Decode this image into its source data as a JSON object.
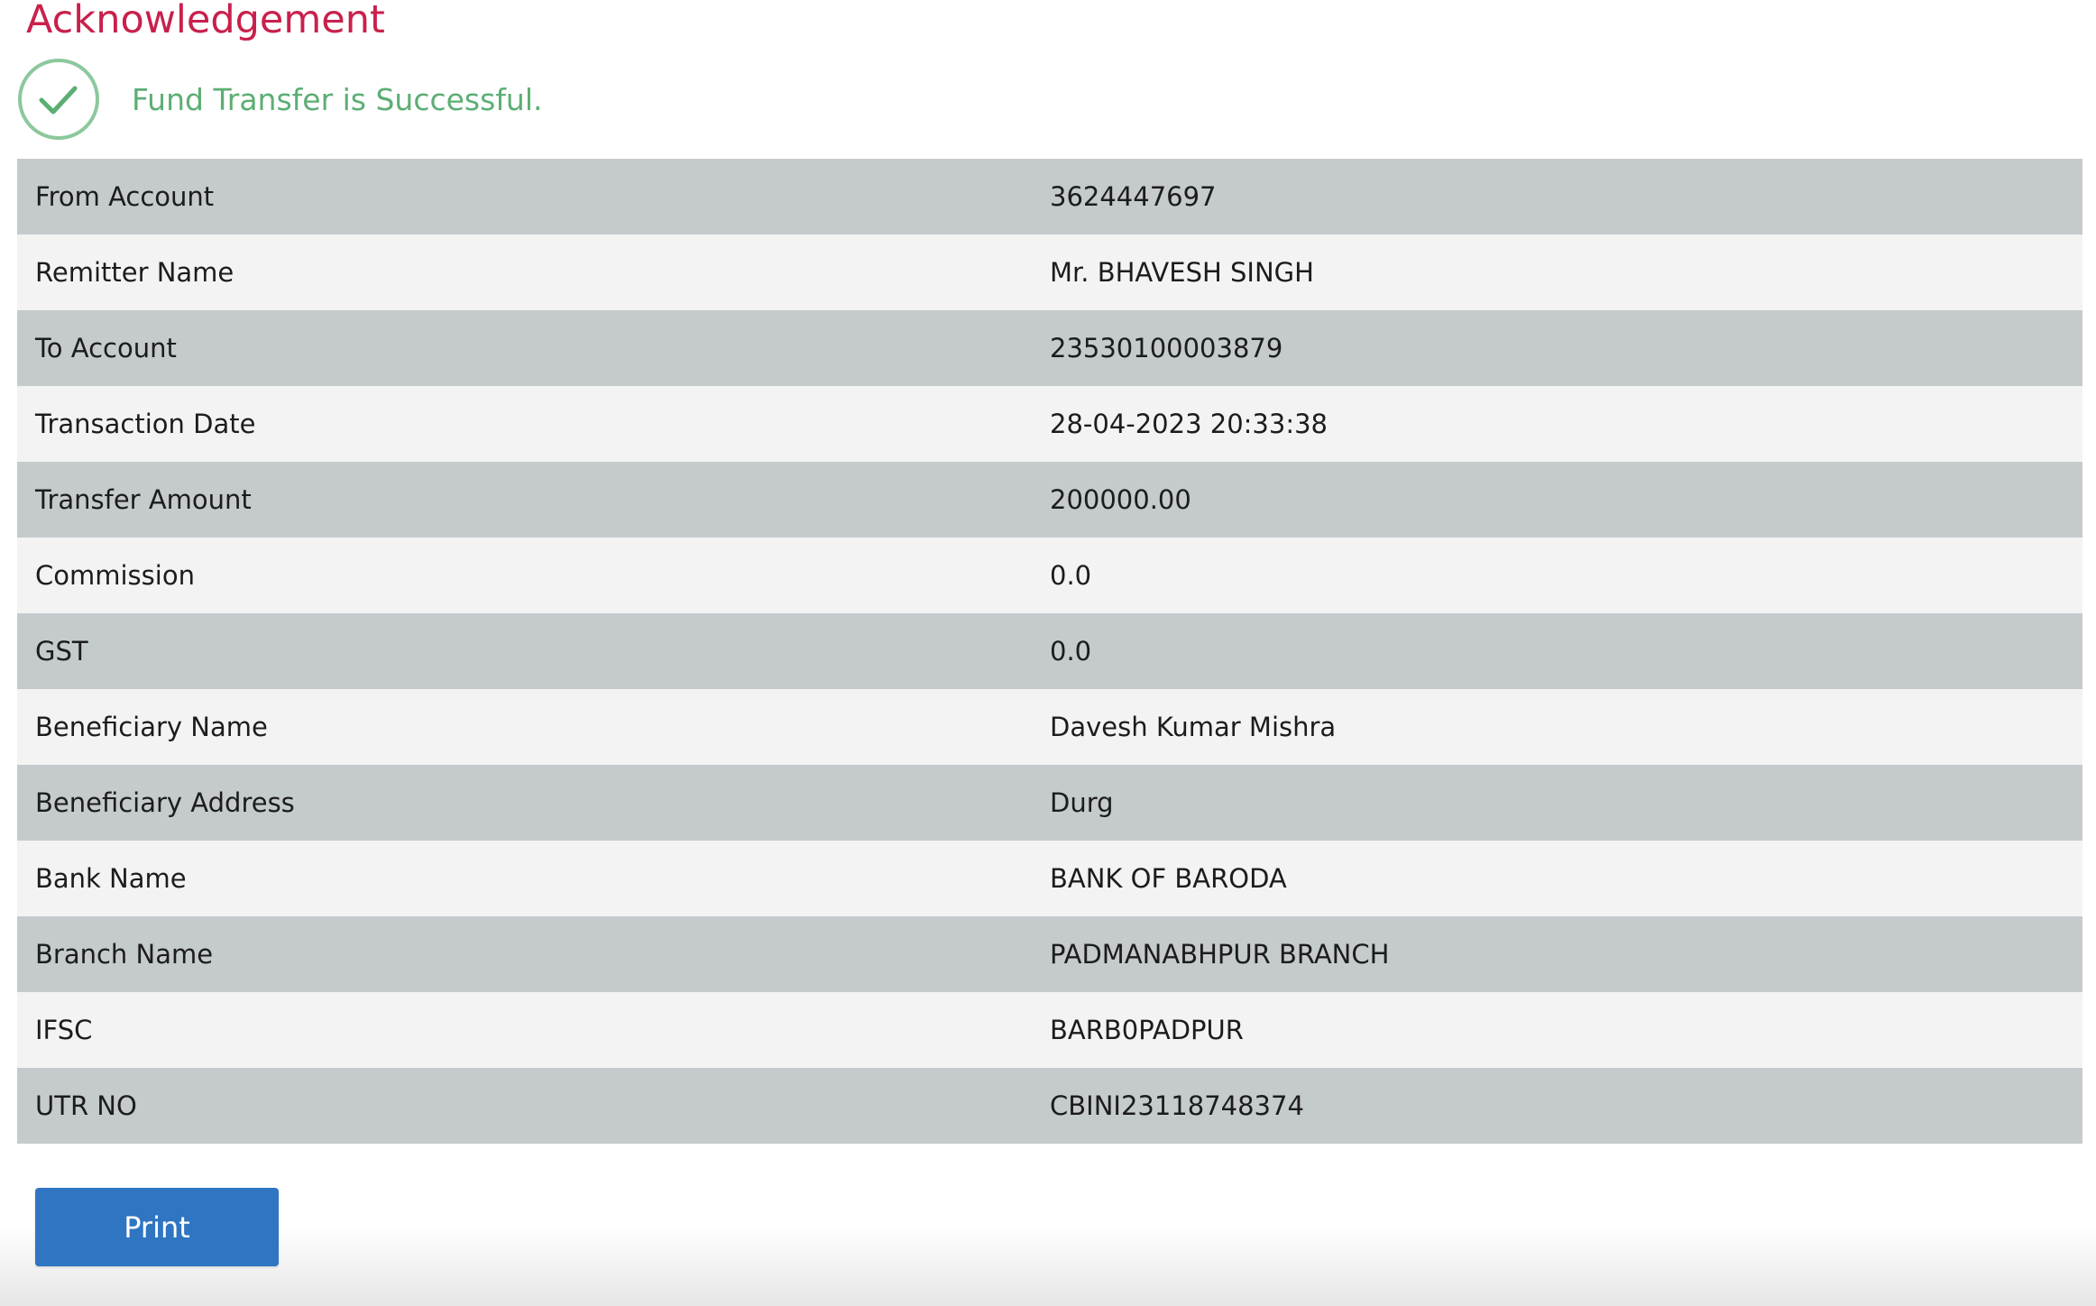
{
  "page": {
    "title": "Acknowledgement",
    "title_color": "#c8204c"
  },
  "status": {
    "message": "Fund Transfer is Successful.",
    "icon": "check-circle-icon",
    "color": "#5cae73"
  },
  "details": [
    {
      "label": "From Account",
      "value": "3624447697"
    },
    {
      "label": "Remitter Name",
      "value": "Mr. BHAVESH SINGH"
    },
    {
      "label": "To Account",
      "value": "23530100003879"
    },
    {
      "label": "Transaction Date",
      "value": "28-04-2023 20:33:38"
    },
    {
      "label": "Transfer Amount",
      "value": "200000.00"
    },
    {
      "label": "Commission",
      "value": "0.0"
    },
    {
      "label": "GST",
      "value": "0.0"
    },
    {
      "label": "Beneficiary Name",
      "value": "Davesh Kumar Mishra"
    },
    {
      "label": "Beneficiary Address",
      "value": "Durg"
    },
    {
      "label": "Bank Name",
      "value": "BANK OF BARODA"
    },
    {
      "label": "Branch Name",
      "value": "PADMANABHPUR BRANCH"
    },
    {
      "label": "IFSC",
      "value": "BARB0PADPUR"
    },
    {
      "label": "UTR NO",
      "value": "CBINI23118748374"
    }
  ],
  "actions": {
    "print_label": "Print",
    "print_color": "#2f75c2"
  }
}
